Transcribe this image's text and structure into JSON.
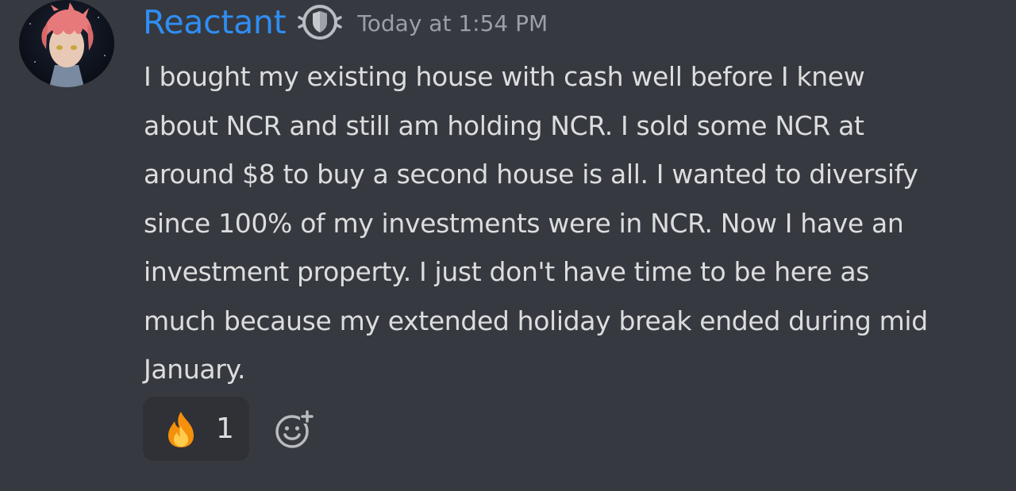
{
  "colors": {
    "background": "#36393f",
    "username": "#2f8ef4",
    "message_text": "#dcddde",
    "timestamp": "#9aa0a8",
    "reaction_background": "#2f3136"
  },
  "message": {
    "author": "Reactant",
    "role_icon": "shield-badge-icon",
    "timestamp": "Today at 1:54 PM",
    "lines": [
      "I bought my existing house with cash well before I knew",
      "about NCR and still am holding NCR. I sold some NCR at",
      "around $8 to buy a second house is all. I wanted to diversify",
      "since 100% of my investments were in NCR. Now I have an",
      "investment property. I just don't have time to be here as",
      "much because my extended holiday break ended during mid",
      "January."
    ]
  },
  "reactions": [
    {
      "emoji": "fire-emoji",
      "count": "1"
    }
  ],
  "add_reaction_icon": "add-reaction-icon"
}
